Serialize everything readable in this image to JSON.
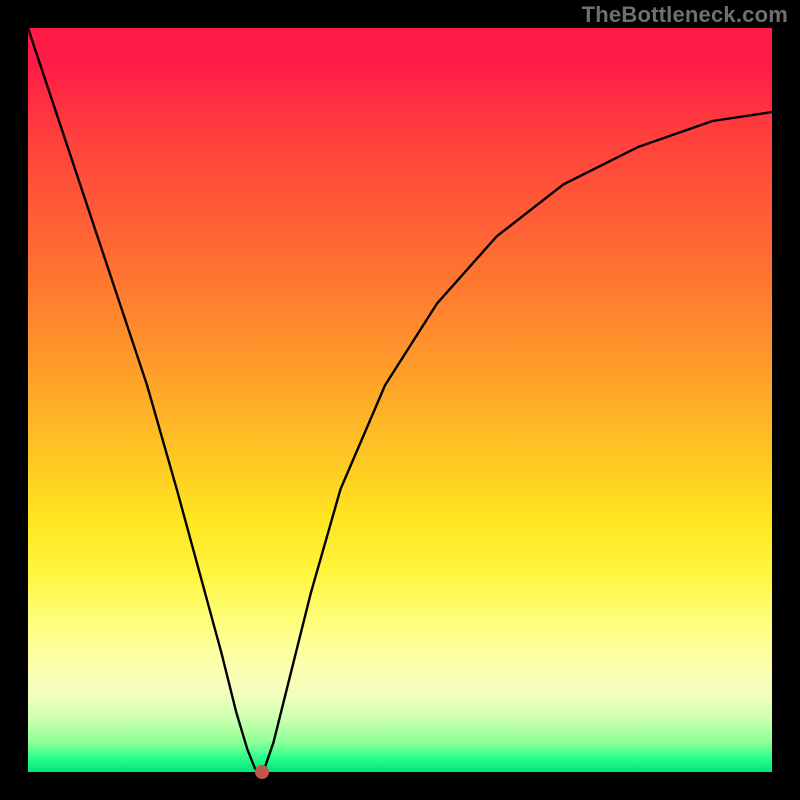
{
  "watermark": "TheBottleneck.com",
  "chart_data": {
    "type": "line",
    "title": "",
    "xlabel": "",
    "ylabel": "",
    "xlim": [
      0,
      100
    ],
    "ylim": [
      0,
      100
    ],
    "grid": false,
    "background": "rainbow-gradient-vertical",
    "gradient_colors_top_to_bottom": [
      "#ff1b47",
      "#ff6a33",
      "#ffc823",
      "#fff53c",
      "#fcffb0",
      "#8dff99",
      "#00e57a"
    ],
    "series": [
      {
        "name": "bottleneck-curve",
        "color": "#000000",
        "x": [
          0,
          4,
          8,
          12,
          16,
          20,
          23,
          26,
          28,
          29.5,
          30.5,
          31,
          31.8,
          33,
          35,
          38,
          42,
          48,
          55,
          63,
          72,
          82,
          92,
          100
        ],
        "y": [
          100,
          88,
          76,
          64,
          52,
          38,
          27,
          16,
          8,
          3,
          0.5,
          0,
          0.5,
          4,
          12,
          24,
          38,
          52,
          63,
          72,
          79,
          84,
          87.5,
          88.7
        ]
      }
    ],
    "marker": {
      "x": 31.5,
      "y": 0,
      "color": "#c25648"
    },
    "annotations": []
  }
}
